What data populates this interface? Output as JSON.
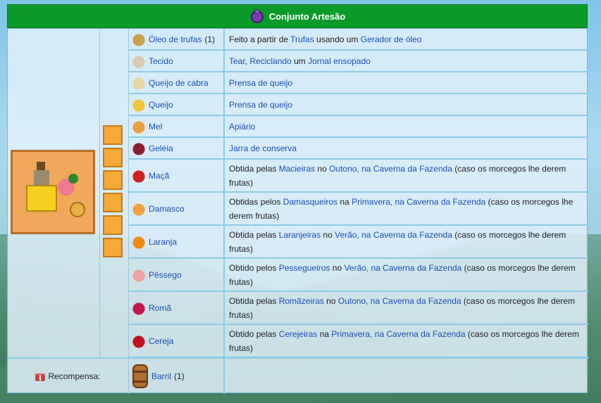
{
  "bundle": {
    "title": "Conjunto Artesão",
    "icon": "purple-bundle-icon",
    "reward_label": "Recompensa:",
    "reward_item": "Barril",
    "reward_qty": "(1)",
    "slots_count": 6
  },
  "items": [
    {
      "name": "Óleo de trufas",
      "qty": "(1)",
      "icon": "truffle-oil-icon",
      "color": "#c8a050",
      "source": [
        {
          "t": "Feito a partir de "
        },
        {
          "l": "Trufas"
        },
        {
          "t": " usando um "
        },
        {
          "l": "Gerador de óleo"
        }
      ]
    },
    {
      "name": "Tecido",
      "qty": "",
      "icon": "cloth-icon",
      "color": "#d8cbb0",
      "source": [
        {
          "l": "Tear"
        },
        {
          "t": ", "
        },
        {
          "l": "Reciclando"
        },
        {
          "t": " um "
        },
        {
          "l": "Jornal ensopado"
        }
      ]
    },
    {
      "name": "Queijo de cabra",
      "qty": "",
      "icon": "goat-cheese-icon",
      "color": "#e8d8a0",
      "source": [
        {
          "l": "Prensa de queijo"
        }
      ]
    },
    {
      "name": "Queijo",
      "qty": "",
      "icon": "cheese-icon",
      "color": "#f2c53a",
      "source": [
        {
          "l": "Prensa de queijo"
        }
      ]
    },
    {
      "name": "Mel",
      "qty": "",
      "icon": "honey-icon",
      "color": "#e8a040",
      "source": [
        {
          "l": "Apiário"
        }
      ]
    },
    {
      "name": "Geléia",
      "qty": "",
      "icon": "jelly-icon",
      "color": "#8a2030",
      "source": [
        {
          "l": "Jarra de conserva"
        }
      ]
    },
    {
      "name": "Maçã",
      "qty": "",
      "icon": "apple-icon",
      "color": "#d02020",
      "source": [
        {
          "t": "Obtida pelas "
        },
        {
          "l": "Macieiras"
        },
        {
          "t": " no "
        },
        {
          "l": "Outono, na Caverna da Fazenda"
        },
        {
          "t": " (caso os morcegos lhe derem frutas)"
        }
      ]
    },
    {
      "name": "Damasco",
      "qty": "",
      "icon": "apricot-icon",
      "color": "#f0a040",
      "source": [
        {
          "t": "Obtidas pelos "
        },
        {
          "l": "Damasqueiros"
        },
        {
          "t": " na "
        },
        {
          "l": "Primavera, na Caverna da Fazenda"
        },
        {
          "t": " (caso os morcegos lhe derem frutas)"
        }
      ]
    },
    {
      "name": "Laranja",
      "qty": "",
      "icon": "orange-icon",
      "color": "#f08a10",
      "source": [
        {
          "t": "Obtida pelas "
        },
        {
          "l": "Laranjeiras"
        },
        {
          "t": " no "
        },
        {
          "l": "Verão, na Caverna da Fazenda"
        },
        {
          "t": " (caso os morcegos lhe derem frutas)"
        }
      ]
    },
    {
      "name": "Pêssego",
      "qty": "",
      "icon": "peach-icon",
      "color": "#f0a0a0",
      "source": [
        {
          "t": "Obtido pelos "
        },
        {
          "l": "Pessegueiros"
        },
        {
          "t": " no "
        },
        {
          "l": "Verão, na Caverna da Fazenda"
        },
        {
          "t": " (caso os morcegos lhe derem frutas)"
        }
      ]
    },
    {
      "name": "Romã",
      "qty": "",
      "icon": "pomegranate-icon",
      "color": "#c01850",
      "source": [
        {
          "t": "Obtida pelas "
        },
        {
          "l": "Romãzeiras"
        },
        {
          "t": " no "
        },
        {
          "l": "Outono, na Caverna da Fazenda"
        },
        {
          "t": " (caso os morcegos lhe derem frutas)"
        }
      ]
    },
    {
      "name": "Cereja",
      "qty": "",
      "icon": "cherry-icon",
      "color": "#c01020",
      "source": [
        {
          "t": "Obtido pelas "
        },
        {
          "l": "Cerejeiras"
        },
        {
          "t": " na "
        },
        {
          "l": "Primavera, na Caverna da Fazenda"
        },
        {
          "t": " (caso os morcegos lhe derem frutas)"
        }
      ]
    }
  ]
}
